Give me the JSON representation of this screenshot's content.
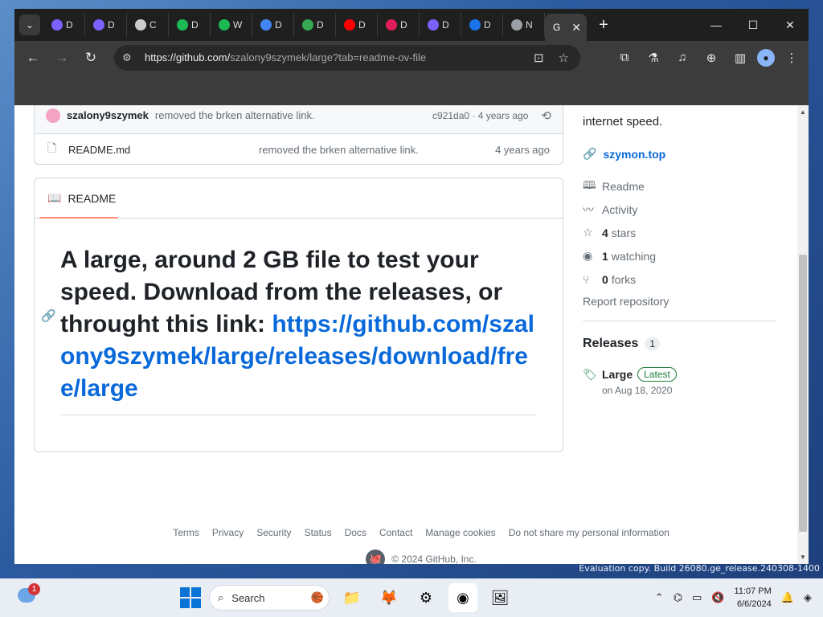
{
  "browser": {
    "tabs": [
      {
        "label": "D",
        "icon": "circle-multicolor-icon",
        "color": "#7b61ff"
      },
      {
        "label": "D",
        "icon": "circle-multicolor-icon",
        "color": "#7b61ff"
      },
      {
        "label": "C",
        "icon": "layers-icon",
        "color": "#cccccc"
      },
      {
        "label": "D",
        "icon": "download-arrow-icon",
        "color": "#1db954"
      },
      {
        "label": "W",
        "icon": "download-arrow-icon",
        "color": "#1db954"
      },
      {
        "label": "D",
        "icon": "google-icon",
        "color": "#4285f4"
      },
      {
        "label": "D",
        "icon": "drive-icon",
        "color": "#34a853"
      },
      {
        "label": "D",
        "icon": "youtube-icon",
        "color": "#ff0000"
      },
      {
        "label": "D",
        "icon": "slack-icon",
        "color": "#e01e5a"
      },
      {
        "label": "D",
        "icon": "circle-multicolor-icon",
        "color": "#7b61ff"
      },
      {
        "label": "D",
        "icon": "download-icon",
        "color": "#1a73e8"
      },
      {
        "label": "N",
        "icon": "globe-icon",
        "color": "#9aa0a6"
      }
    ],
    "active_tab": {
      "label": "G",
      "close": "✕"
    },
    "new_tab": "+",
    "window_controls": {
      "minimize": "—",
      "maximize": "☐",
      "close": "✕"
    },
    "address": {
      "host": "https://github.com/",
      "path": "szalony9szymek/large?tab=readme-ov-file"
    }
  },
  "repo": {
    "latest_commit": {
      "author": "szalony9szymek",
      "message": "removed the brken alternative link.",
      "sha_age": "c921da0 · 4 years ago"
    },
    "files": [
      {
        "name": "README.md",
        "message": "removed the brken alternative link.",
        "date": "4 years ago"
      }
    ],
    "readme": {
      "tab_label": "README",
      "heading": "A large, around 2 GB file to test your speed. Download from the releases, or throught this link:",
      "link": "https://github.com/szalony9szymek/large/releases/download/free/large"
    },
    "sidebar": {
      "about_tail": "internet speed.",
      "website": "szymon.top",
      "items": [
        {
          "icon": "book-icon",
          "count": "",
          "label": "Readme"
        },
        {
          "icon": "activity-icon",
          "count": "",
          "label": "Activity"
        },
        {
          "icon": "star-icon",
          "count": "4",
          "label": "stars"
        },
        {
          "icon": "eye-icon",
          "count": "1",
          "label": "watching"
        },
        {
          "icon": "fork-icon",
          "count": "0",
          "label": "forks"
        }
      ],
      "report": "Report repository",
      "releases_title": "Releases",
      "releases_count": "1",
      "release": {
        "name": "Large",
        "badge": "Latest",
        "date": "on Aug 18, 2020"
      }
    },
    "footer": {
      "links": [
        "Terms",
        "Privacy",
        "Security",
        "Status",
        "Docs",
        "Contact",
        "Manage cookies",
        "Do not share my personal information"
      ],
      "copyright": "© 2024 GitHub, Inc."
    }
  },
  "taskbar": {
    "weather_badge": "1",
    "search_label": "Search",
    "time": "11:07 PM",
    "date": "6/6/2024"
  },
  "desktop": {
    "eval_text": "Evaluation copy. Build 26080.ge_release.240308-1400"
  }
}
